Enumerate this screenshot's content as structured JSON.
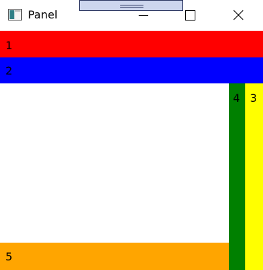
{
  "window": {
    "title": "Panel"
  },
  "icons": {
    "app": "app-window-icon",
    "minimize": "minimize-icon",
    "maximize": "maximize-icon",
    "close": "close-icon"
  },
  "panels": [
    {
      "label": "1",
      "color": "#ff0000",
      "dock": "top"
    },
    {
      "label": "2",
      "color": "#0000ff",
      "dock": "top"
    },
    {
      "label": "3",
      "color": "#ffff00",
      "dock": "right"
    },
    {
      "label": "4",
      "color": "#008000",
      "dock": "right"
    },
    {
      "label": "5",
      "color": "#ffa500",
      "dock": "bottom"
    }
  ],
  "colors": {
    "handle_fill": "#cdd6ee",
    "handle_border": "#2a3560",
    "background": "#ffffff"
  }
}
